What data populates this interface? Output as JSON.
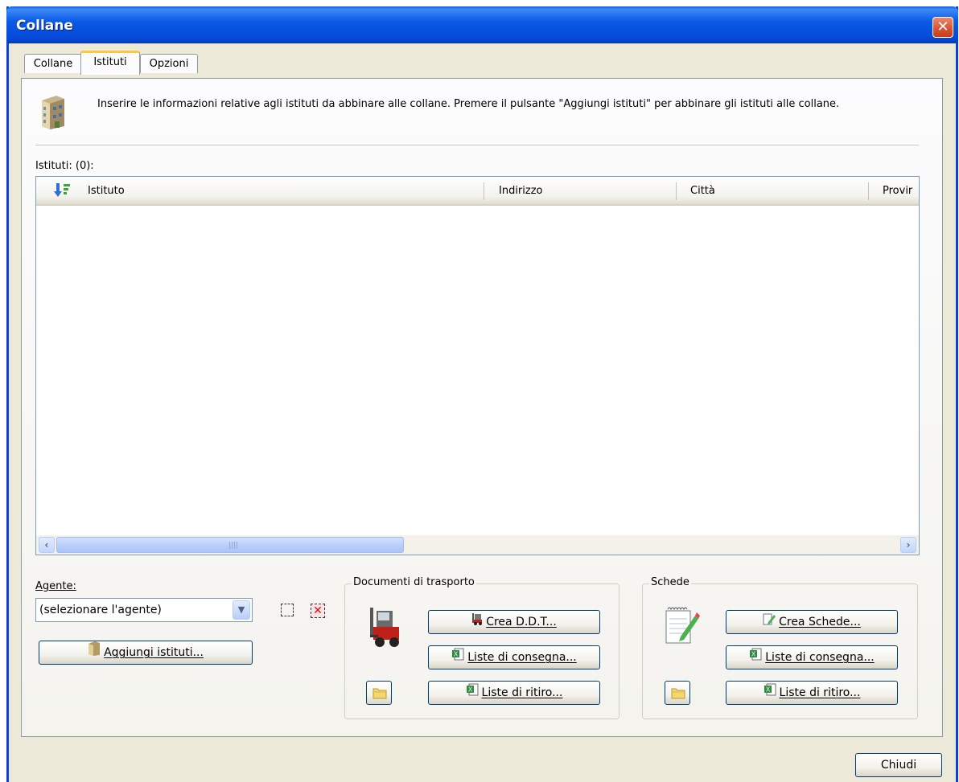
{
  "window": {
    "title": "Collane",
    "close_glyph": "✕"
  },
  "tabs": [
    {
      "label": "Collane",
      "active": false
    },
    {
      "label": "Istituti",
      "active": true
    },
    {
      "label": "Opzioni",
      "active": false
    }
  ],
  "info": {
    "icon": "building-icon",
    "text": "Inserire le informazioni relative agli istituti da abbinare alle collane. Premere il pulsante \"Aggiungi istituti\" per abbinare gli istituti alle collane."
  },
  "istituti_list": {
    "label": "Istituti: (0):",
    "columns": [
      "Istituto",
      "Indirizzo",
      "Città",
      "Provir"
    ],
    "rows": []
  },
  "agente": {
    "label": "Agente:",
    "selected": "(selezionare l'agente)",
    "add_button": "Aggiungi istituti..."
  },
  "ddt_group": {
    "title": "Documenti di trasporto",
    "crea_button": "Crea D.D.T...",
    "consegna_button": "Liste di consegna...",
    "ritiro_button": "Liste di ritiro..."
  },
  "schede_group": {
    "title": "Schede",
    "crea_button": "Crea Schede...",
    "consegna_button": "Liste di consegna...",
    "ritiro_button": "Liste di ritiro..."
  },
  "footer": {
    "close_button": "Chiudi"
  },
  "colors": {
    "titlebar": "#0a5ae6",
    "face": "#ece9d8",
    "tab_highlight": "#ffc83c"
  }
}
